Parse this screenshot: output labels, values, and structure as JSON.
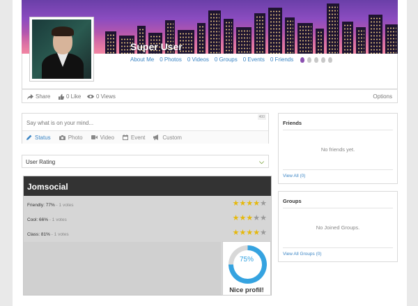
{
  "profile": {
    "name": "Super User",
    "stats": [
      "About Me",
      "0 Photos",
      "0 Videos",
      "0 Groups",
      "0 Events",
      "0 Friends"
    ],
    "drop_colors": [
      "#8a4fb0",
      "#c8c8c8",
      "#c8c8c8",
      "#c8c8c8",
      "#c8c8c8"
    ]
  },
  "actions": {
    "share": "Share",
    "like": "0 Like",
    "views": "0 Views",
    "options": "Options"
  },
  "status": {
    "placeholder": "Say what is on your mind...",
    "counter": "400",
    "tabs": [
      "Status",
      "Photo",
      "Video",
      "Event",
      "Custom"
    ]
  },
  "rating": {
    "label": "User Rating"
  },
  "jomsocial": {
    "title": "Jomsocial",
    "rows": [
      {
        "label": "Friendly: 77%",
        "votes": " - 1 votes",
        "stars": 4
      },
      {
        "label": "Cool: 66%",
        "votes": " - 1 votes",
        "stars": 3
      },
      {
        "label": "Class: 81%",
        "votes": " - 1 votes",
        "stars": 4
      }
    ],
    "score_value": 75,
    "score": "75%",
    "score_text": "Nice profil!"
  },
  "friends_widget": {
    "title": "Friends",
    "empty": "No friends yet.",
    "view_all": "View All (0)"
  },
  "groups_widget": {
    "title": "Groups",
    "empty": "No Joined Groups.",
    "view_all": "View All Groups (0)"
  },
  "colors": {
    "link": "#3a84c4",
    "star": "#e5b80b",
    "accent": "#35a3e0"
  }
}
